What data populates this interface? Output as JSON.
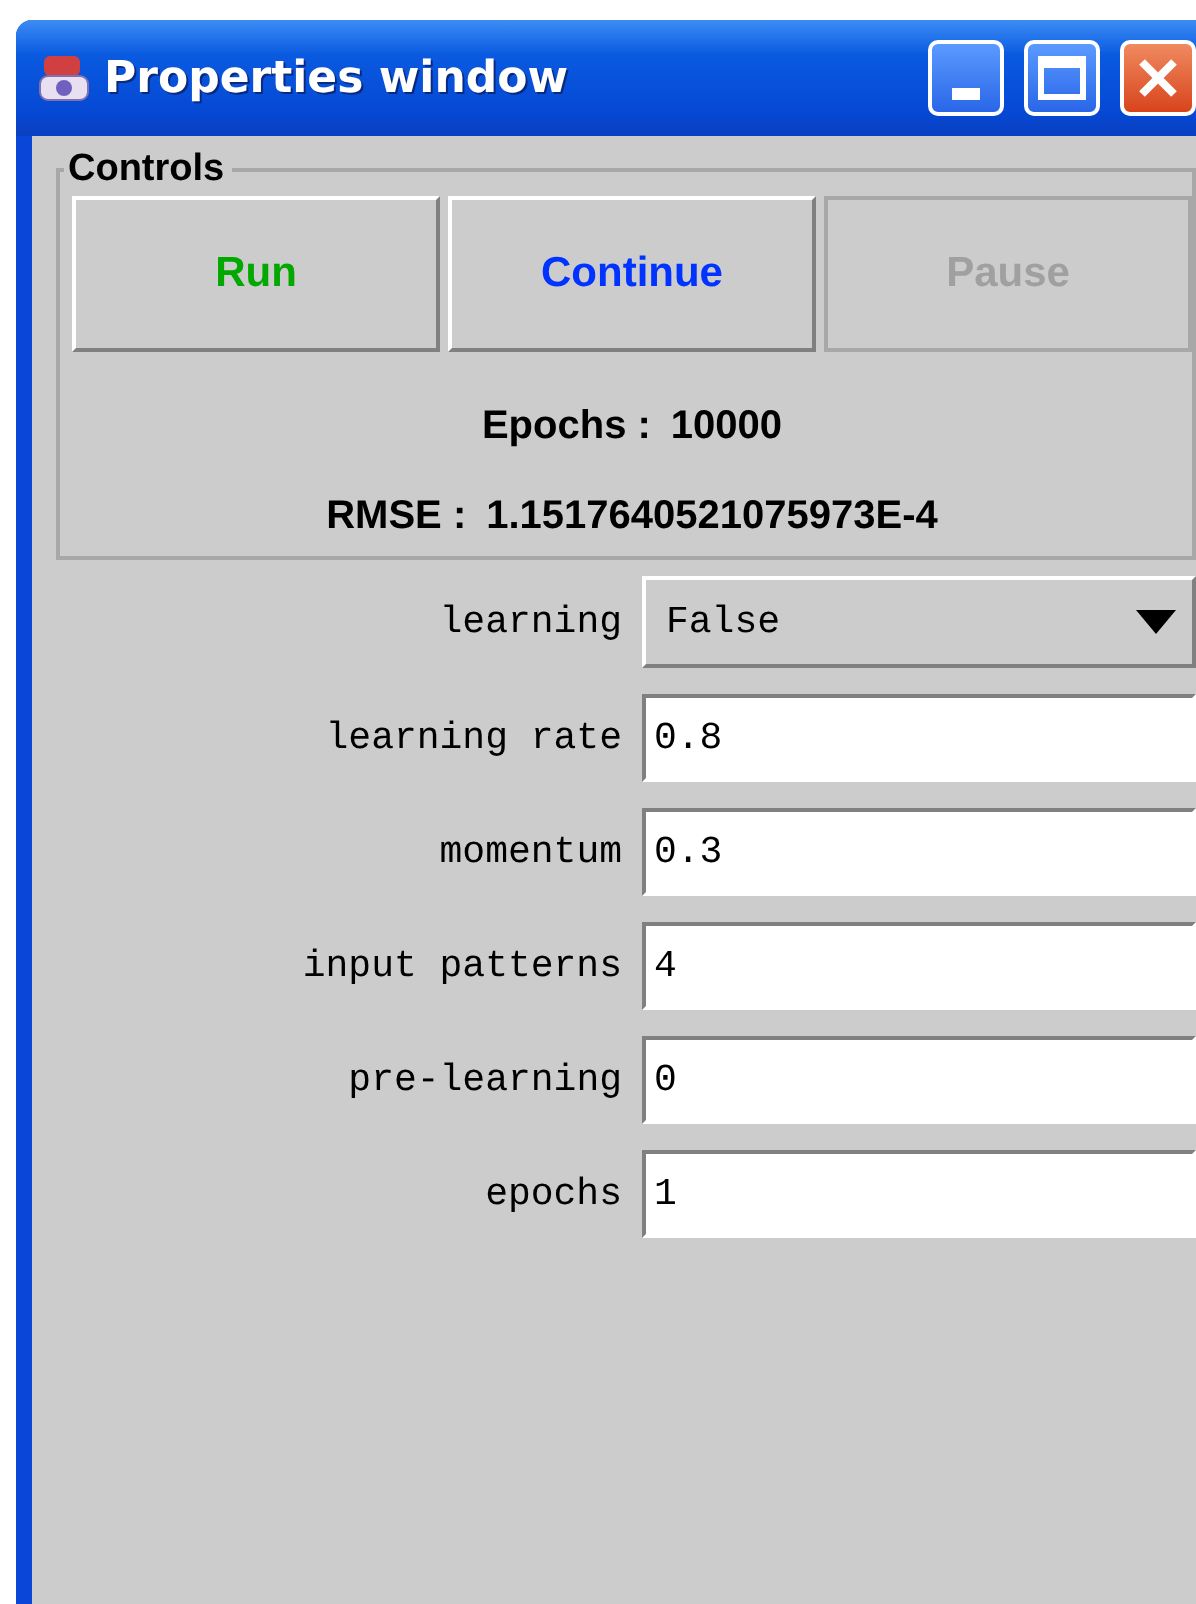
{
  "window": {
    "title": "Properties window"
  },
  "controls": {
    "title": "Controls",
    "buttons": [
      {
        "label": "Run",
        "color": "#00a800",
        "disabled": false
      },
      {
        "label": "Continue",
        "color": "#0033ff",
        "disabled": false
      },
      {
        "label": "Pause",
        "disabled": true
      }
    ],
    "stats": [
      {
        "label": "Epochs :",
        "value": "10000"
      },
      {
        "label": "RMSE :",
        "value": "1.1517640521075973E-4"
      }
    ]
  },
  "properties": [
    {
      "label": "learning",
      "kind": "dropdown",
      "value": "False"
    },
    {
      "label": "learning rate",
      "kind": "text",
      "value": "0.8"
    },
    {
      "label": "momentum",
      "kind": "text",
      "value": "0.3"
    },
    {
      "label": "input patterns",
      "kind": "text",
      "value": "4"
    },
    {
      "label": "pre-learning",
      "kind": "text",
      "value": "0"
    },
    {
      "label": "epochs",
      "kind": "text",
      "value": "1"
    }
  ]
}
